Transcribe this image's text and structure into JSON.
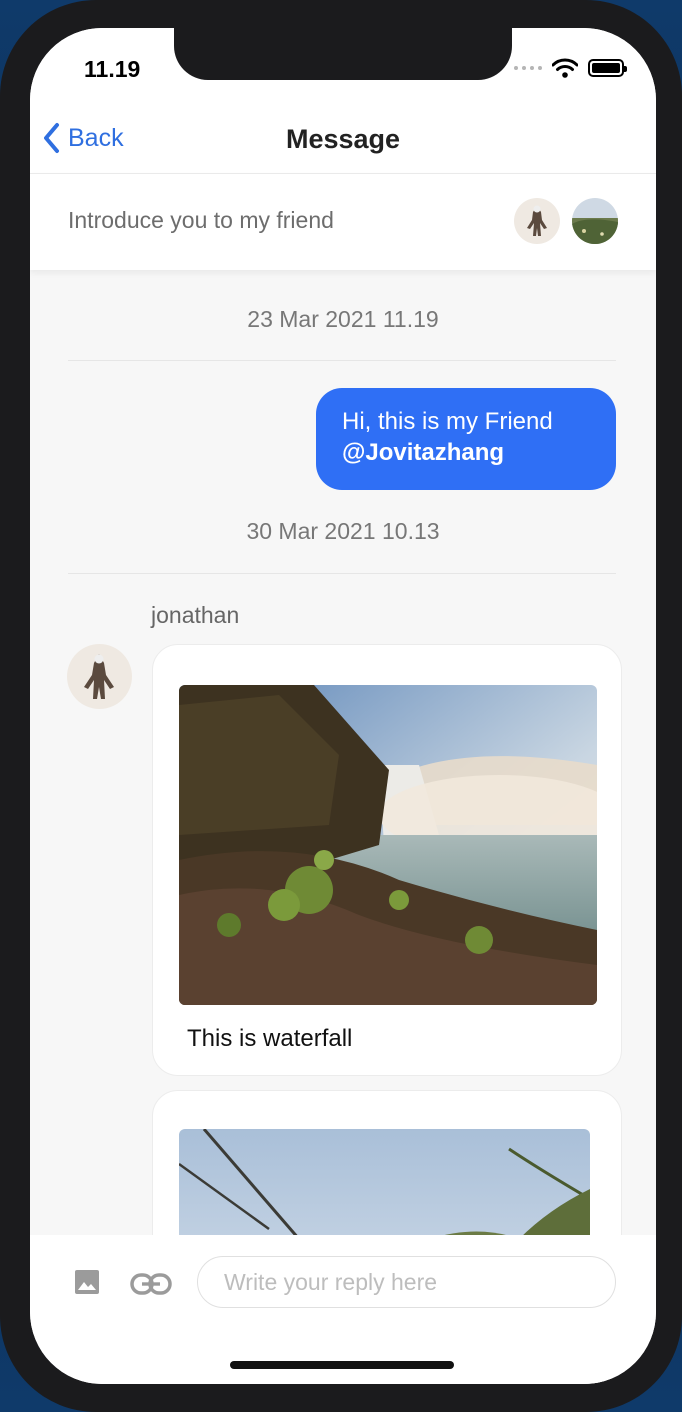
{
  "status_bar": {
    "time": "11.19"
  },
  "nav": {
    "back_label": "Back",
    "title": "Message"
  },
  "thread": {
    "subject": "Introduce you to my friend"
  },
  "messages": {
    "date_1": "23 Mar 2021 11.19",
    "outgoing_1": {
      "text": "Hi, this is my Friend",
      "mention": "@Jovitazhang"
    },
    "date_2": "30 Mar 2021 10.13",
    "incoming_sender": "jonathan",
    "incoming_1": {
      "caption": "This is waterfall"
    }
  },
  "composer": {
    "placeholder": "Write your reply here"
  },
  "colors": {
    "accent": "#2f6ff5",
    "link": "#2f6fe0",
    "background": "#f7f7f7"
  },
  "icons": [
    "chevron-left-icon",
    "image-icon",
    "link-icon",
    "wifi-icon",
    "battery-icon"
  ]
}
